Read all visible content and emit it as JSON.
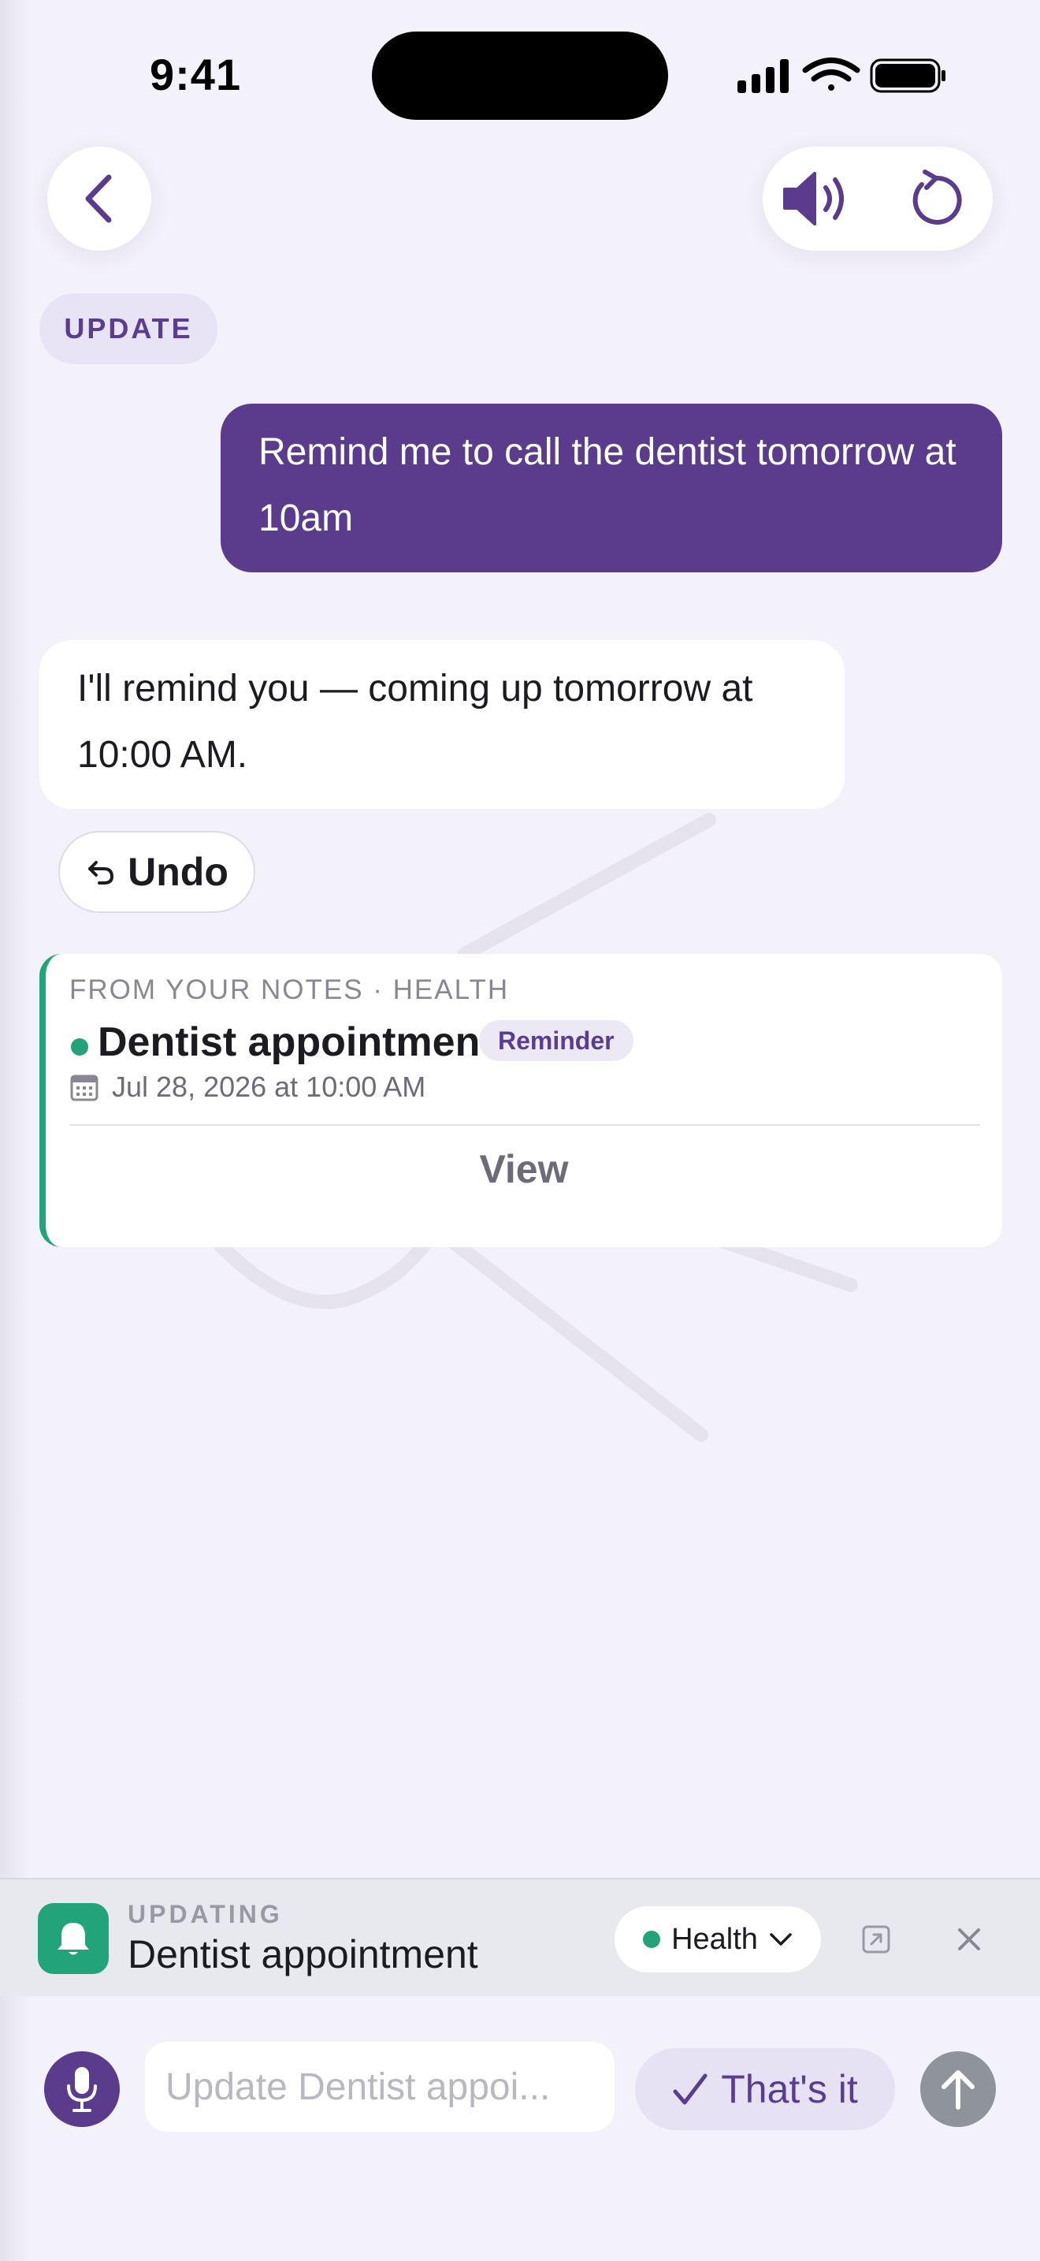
{
  "status_bar": {
    "time": "9:41"
  },
  "mode_chip": "UPDATE",
  "messages": {
    "user": "Remind me to call the dentist tomorrow at 10am",
    "assistant": "I'll remind you — coming up tomorrow at 10:00 AM."
  },
  "undo": {
    "label": "Undo"
  },
  "note_card": {
    "source": "FROM YOUR NOTES · HEALTH",
    "title": "Dentist appointment",
    "tag": "Reminder",
    "date": "Jul 28, 2026 at 10:00 AM",
    "view_label": "View",
    "accent_color": "#22a37a"
  },
  "updating_bar": {
    "label": "UPDATING",
    "title": "Dentist appointment",
    "category": "Health"
  },
  "composer": {
    "placeholder": "Update Dentist appoi...",
    "done_label": "That's it"
  },
  "colors": {
    "primary": "#5b3b8c",
    "success": "#22a37a",
    "background": "#f3f1f9"
  },
  "icons": [
    "back-chevron-icon",
    "speaker-icon",
    "refresh-icon",
    "undo-arrow-icon",
    "calendar-icon",
    "bell-icon",
    "chevron-down-icon",
    "open-external-icon",
    "close-icon",
    "microphone-icon",
    "checkmark-icon",
    "arrow-up-icon"
  ]
}
